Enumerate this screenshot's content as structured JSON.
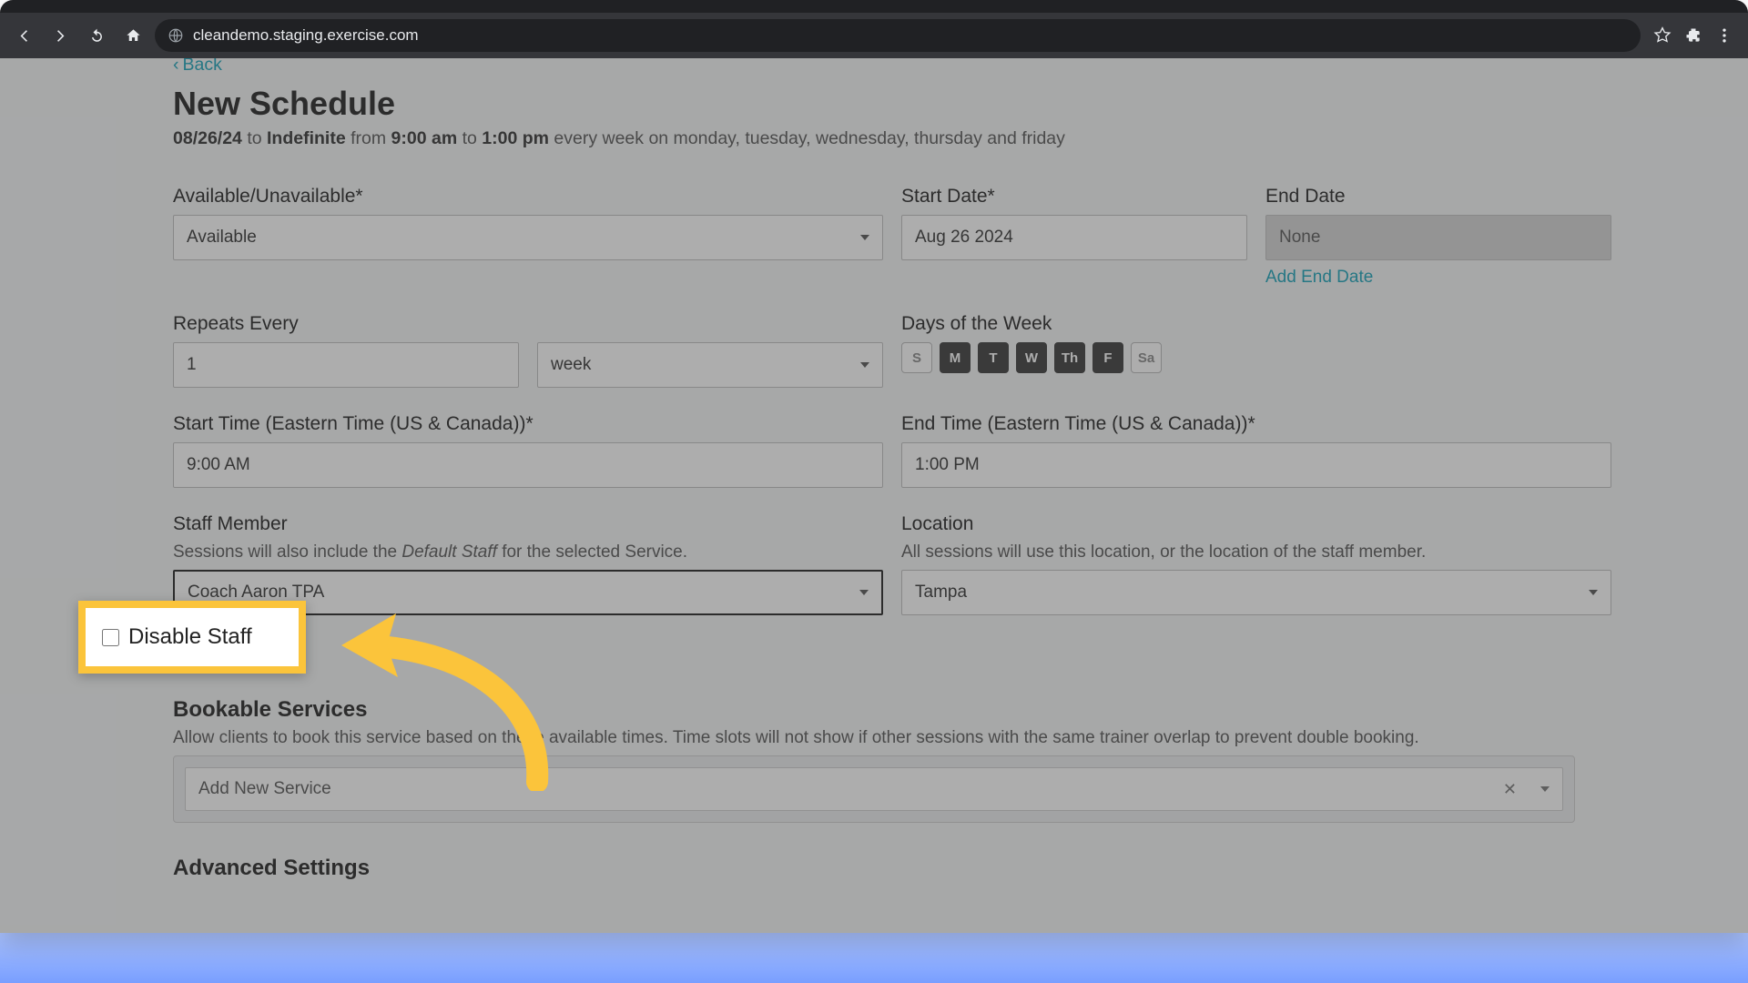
{
  "browser": {
    "url": "cleandemo.staging.exercise.com"
  },
  "page": {
    "back": "Back",
    "title": "New Schedule",
    "subtitle_parts": {
      "date": "08/26/24",
      "to": "to",
      "indef": "Indefinite",
      "from": "from",
      "t1": "9:00 am",
      "mid": "to",
      "t2": "1:00 pm",
      "rest": "every week on monday, tuesday, wednesday, thursday and friday"
    }
  },
  "fields": {
    "available_label": "Available/Unavailable*",
    "available_value": "Available",
    "start_date_label": "Start Date*",
    "start_date_value": "Aug 26 2024",
    "end_date_label": "End Date",
    "end_date_value": "None",
    "add_end_date": "Add End Date",
    "repeats_label": "Repeats Every",
    "repeats_value": "1",
    "repeats_unit": "week",
    "dow_label": "Days of the Week",
    "dow": [
      "S",
      "M",
      "T",
      "W",
      "Th",
      "F",
      "Sa"
    ],
    "start_time_label": "Start Time (Eastern Time (US & Canada))*",
    "start_time_value": "9:00 AM",
    "end_time_label": "End Time (Eastern Time (US & Canada))*",
    "end_time_value": "1:00 PM",
    "staff_label": "Staff Member",
    "staff_helper_pre": "Sessions will also include the ",
    "staff_helper_italic": "Default Staff",
    "staff_helper_post": " for the selected Service.",
    "staff_value": "Coach Aaron TPA",
    "disable_staff": "Disable Staff",
    "location_label": "Location",
    "location_helper": "All sessions will use this location, or the location of the staff member.",
    "location_value": "Tampa",
    "bookable_title": "Bookable Services",
    "bookable_helper": "Allow clients to book this service based on these available times. Time slots will not show if other sessions with the same trainer overlap to prevent double booking.",
    "add_service": "Add New Service",
    "advanced_title": "Advanced Settings"
  }
}
